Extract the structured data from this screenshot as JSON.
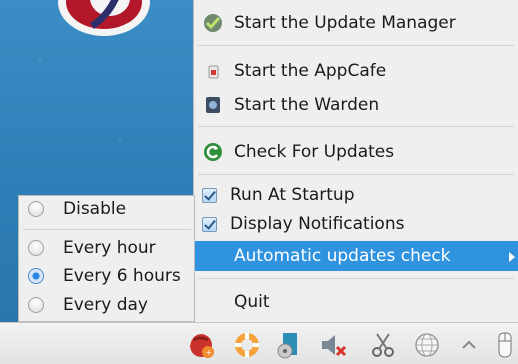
{
  "menu": {
    "items": [
      {
        "label": "Start the Update Manager",
        "icon": "update-manager-icon"
      },
      {
        "label": "Start the AppCafe",
        "icon": "appcafe-icon"
      },
      {
        "label": "Start the Warden",
        "icon": "warden-icon"
      },
      {
        "label": "Check For Updates",
        "icon": "refresh-icon"
      }
    ],
    "toggles": [
      {
        "label": "Run At Startup",
        "checked": true
      },
      {
        "label": "Display Notifications",
        "checked": true
      }
    ],
    "submenu_label": "Automatic updates check",
    "quit_label": "Quit"
  },
  "submenu": {
    "options": [
      {
        "label": "Disable",
        "selected": false
      },
      {
        "label": "Every hour",
        "selected": false
      },
      {
        "label": "Every 6 hours",
        "selected": true
      },
      {
        "label": "Every day",
        "selected": false
      }
    ]
  },
  "tray": {
    "icons": [
      "update-tray-icon",
      "lifebuoy-icon",
      "media-icon",
      "volume-muted-icon",
      "scissors-icon",
      "network-icon",
      "expand-tray-icon",
      "mouse-icon"
    ]
  },
  "colors": {
    "highlight": "#2f93e0",
    "menu_bg": "#efefef",
    "desktop": "#2e7db6"
  }
}
